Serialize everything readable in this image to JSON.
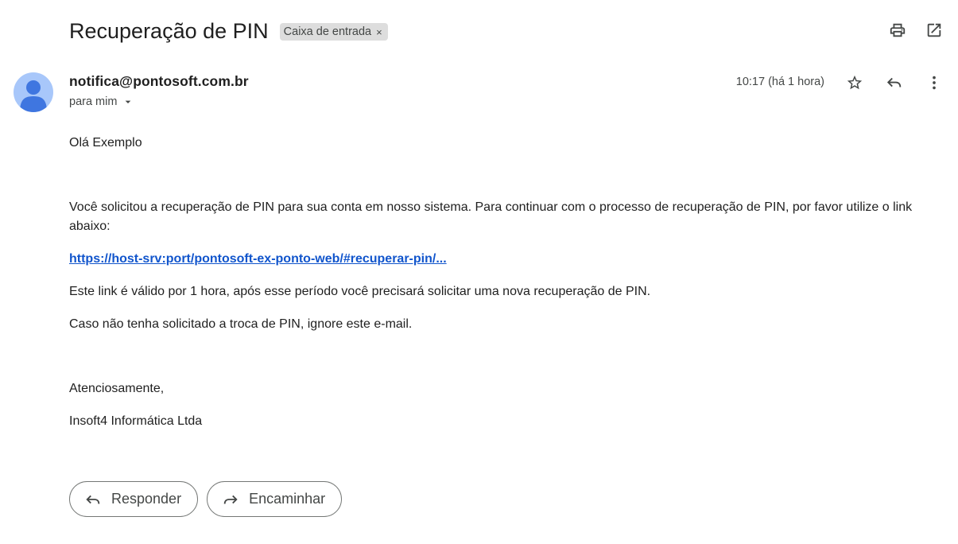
{
  "header": {
    "subject": "Recuperação de PIN",
    "label_chip": "Caixa de entrada",
    "label_close": "×",
    "actions": [
      "print-icon",
      "open-in-new-window-icon"
    ]
  },
  "message": {
    "sender": "notifica@pontosoft.com.br",
    "recipient": "para mim",
    "timestamp": "10:17 (há 1 hora)",
    "actions": [
      "star-icon",
      "reply-icon",
      "more-vert-icon"
    ]
  },
  "body": {
    "greeting": "Olá Exemplo",
    "intro": "Você solicitou a recuperação de PIN para sua conta em nosso sistema. Para continuar com o processo de recuperação de PIN, por favor utilize o link abaixo:",
    "link": "https://host-srv:port/pontosoft-ex-ponto-web/#recuperar-pin/...",
    "validity": "Este link é válido por 1 hora, após esse período você precisará solicitar uma nova recuperação de PIN.",
    "ignore_note": "Caso não tenha solicitado a troca de PIN, ignore este e-mail.",
    "regards": "Atenciosamente,",
    "signature": "Insoft4 Informática Ltda"
  },
  "footer": {
    "reply_label": "Responder",
    "forward_label": "Encaminhar"
  },
  "colors": {
    "link": "#1155cc",
    "avatar_bg": "#a8c7fa",
    "avatar_fg": "#3f76e0",
    "chip_bg": "#dddddd"
  }
}
